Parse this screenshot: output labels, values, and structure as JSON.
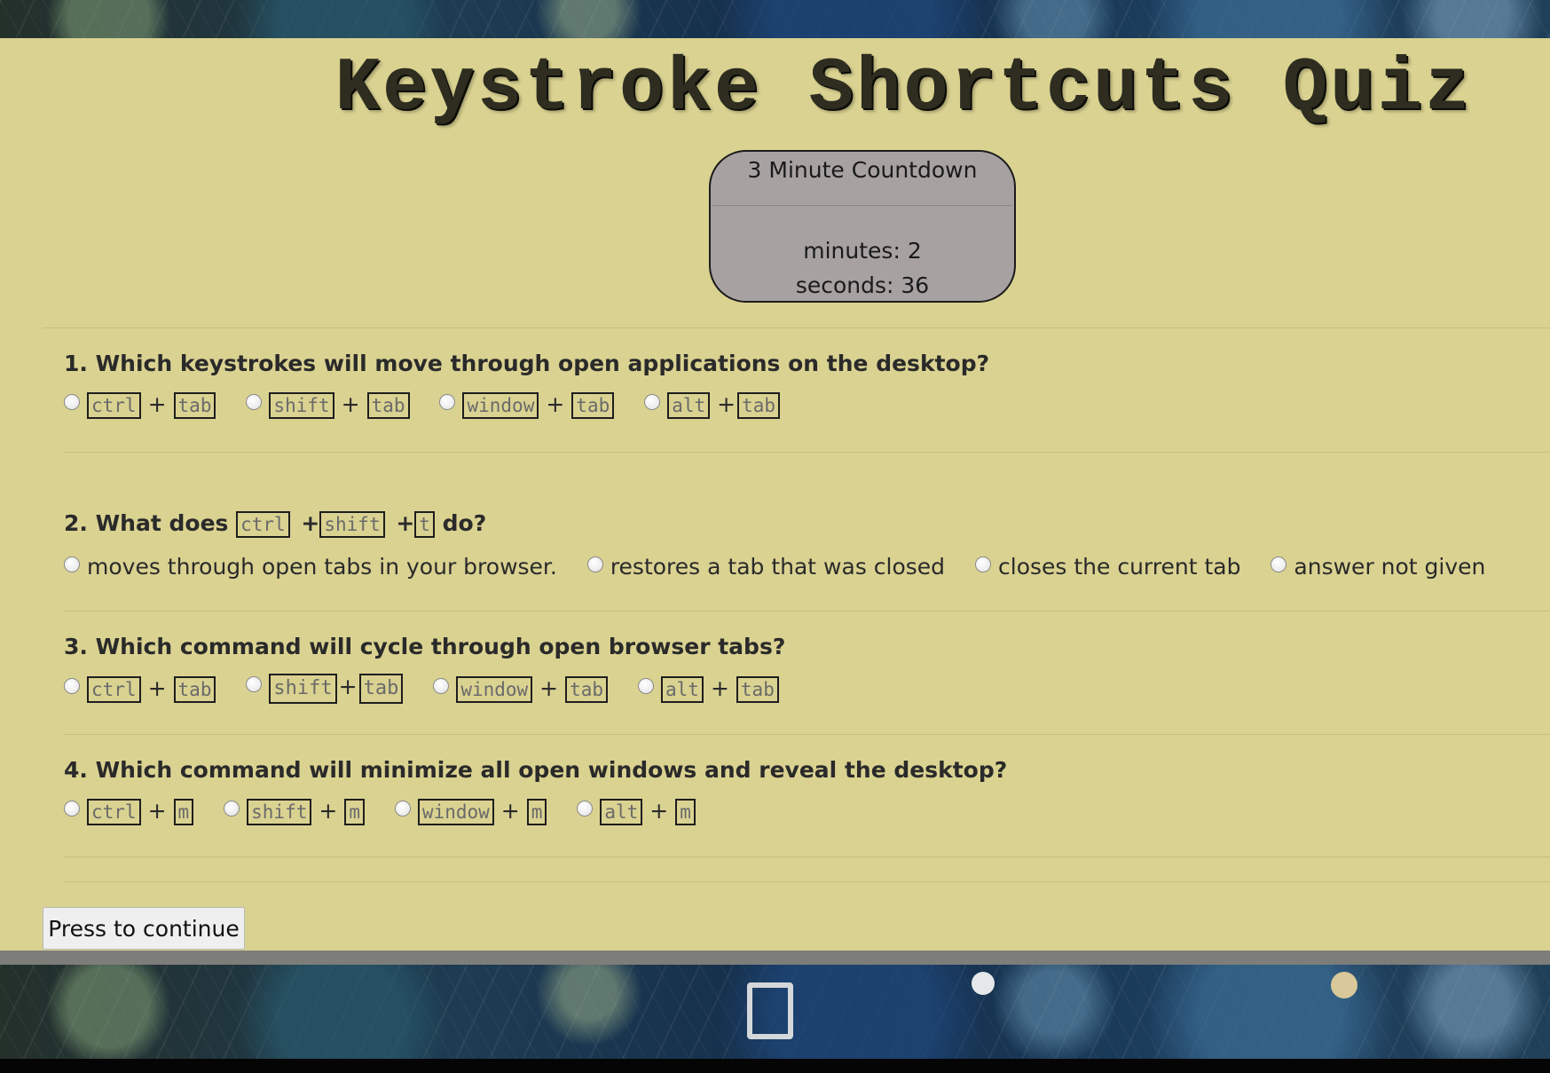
{
  "title": "Keystroke Shortcuts Quiz",
  "countdown": {
    "title": "3 Minute Countdown",
    "minutes_line": "minutes: 2",
    "seconds_line": "seconds: 36"
  },
  "plus": "+",
  "questions": [
    {
      "text": "1. Which keystrokes will move through open applications on the desktop?",
      "options": [
        {
          "k1": "ctrl",
          "k2": "tab"
        },
        {
          "k1": "shift",
          "k2": "tab"
        },
        {
          "k1": "window",
          "k2": "tab"
        },
        {
          "k1": "alt",
          "k2": "tab"
        }
      ]
    },
    {
      "text_prefix": "2. What does",
      "keys": [
        "ctrl",
        "shift",
        "t"
      ],
      "text_suffix": "do?",
      "options": [
        "moves through open tabs in your browser.",
        "restores a tab that was closed",
        "closes the current tab",
        "answer not given"
      ]
    },
    {
      "text": "3. Which command will cycle through open browser tabs?",
      "options": [
        {
          "k1": "ctrl",
          "k2": "tab"
        },
        {
          "k1": "shift",
          "k2": "tab"
        },
        {
          "k1": "window",
          "k2": "tab"
        },
        {
          "k1": "alt",
          "k2": "tab"
        }
      ]
    },
    {
      "text": "4. Which command will minimize all open windows and reveal the desktop?",
      "options": [
        {
          "k1": "ctrl",
          "k2": "m"
        },
        {
          "k1": "shift",
          "k2": "m"
        },
        {
          "k1": "window",
          "k2": "m"
        },
        {
          "k1": "alt",
          "k2": "m"
        }
      ]
    }
  ],
  "continue_button": "Press to continue",
  "colors": {
    "panel_background": "#dad291",
    "countdown_background": "#a8a1a1",
    "title_text": "#2e2d20"
  }
}
